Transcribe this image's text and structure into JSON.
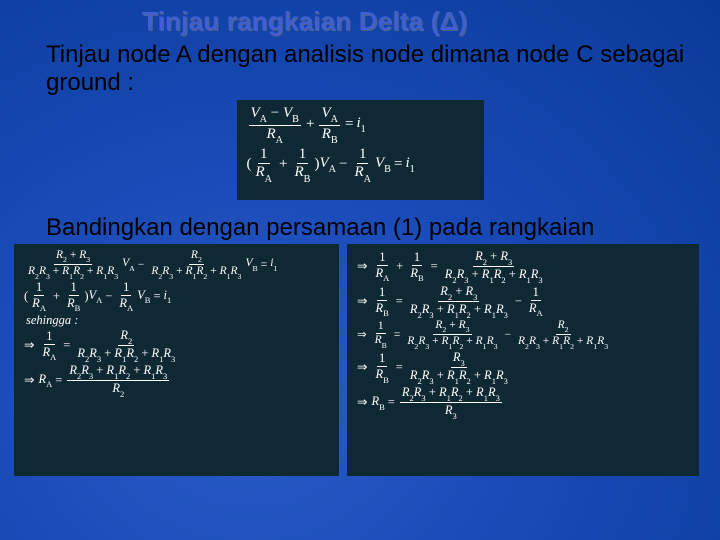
{
  "title": "Tinjau rangkaian Delta (Δ)",
  "para1": "Tinjau node A dengan analisis node dimana node C sebagai ground :",
  "para2": "Bandingkan dengan persamaan (1) pada rangkaian",
  "eq_top": {
    "l1": {
      "num1": "V_A − V_B",
      "den1": "R_A",
      "plus": "+",
      "num2": "V_A",
      "den2": "R_B",
      "eq": "=",
      "rhs": "i_1"
    },
    "l2": {
      "open": "(",
      "num1": "1",
      "den1": "R_A",
      "plus": "+",
      "num2": "1",
      "den2": "R_B",
      "close": ")",
      "VA": "V_A",
      "minus": "−",
      "num3": "1",
      "den3": "R_A",
      "VB": "V_B",
      "eq": "=",
      "rhs": "i_1"
    }
  },
  "eq_left": {
    "l1": {
      "num1": "R_2 + R_3",
      "den1": "R_2R_3 + R_1R_2 + R_1R_3",
      "VA": "V_A",
      "minus": "−",
      "num2": "R_2",
      "den2": "R_2R_3 + R_1R_2 + R_1R_3",
      "VB": "V_B",
      "eq": "=",
      "rhs": "i_1"
    },
    "l2": {
      "open": "(",
      "num1": "1",
      "den1": "R_A",
      "plus": "+",
      "num2": "1",
      "den2": "R_B",
      "close": ")",
      "VA": "V_A",
      "minus": "−",
      "num3": "1",
      "den3": "R_A",
      "VB": "V_B",
      "eq": "=",
      "rhs": "i_1"
    },
    "l3": "sehingga :",
    "l4": {
      "num1": "1",
      "den1": "R_A",
      "eq": "=",
      "num2": "R_2",
      "den2": "R_2R_3 + R_1R_2 + R_1R_3"
    },
    "l5": {
      "RA": "R_A",
      "eq": "=",
      "num": "R_2R_3 + R_1R_2 + R_1R_3",
      "den": "R_2"
    }
  },
  "eq_right": {
    "l1": {
      "num1": "1",
      "den1": "R_A",
      "plus": "+",
      "num2": "1",
      "den2": "R_B",
      "eq": "=",
      "num3": "R_2 + R_3",
      "den3": "R_2R_3 + R_1R_2 + R_1R_3"
    },
    "l2": {
      "num1": "1",
      "den1": "R_B",
      "eq": "=",
      "num2": "R_2 + R_3",
      "den2": "R_2R_3 + R_1R_2 + R_1R_3",
      "minus": "−",
      "num3": "1",
      "den3": "R_A"
    },
    "l3": {
      "num1": "1",
      "den1": "R_B",
      "eq": "=",
      "num2": "R_2 + R_3",
      "den2": "R_2R_3 + R_1R_2 + R_1R_3",
      "minus": "−",
      "num3": "R_2",
      "den3": "R_2R_3 + R_1R_2 + R_1R_3"
    },
    "l4": {
      "num1": "1",
      "den1": "R_B",
      "eq": "=",
      "num2": "R_3",
      "den2": "R_2R_3 + R_1R_2 + R_1R_3"
    },
    "l5": {
      "RB": "R_B",
      "eq": "=",
      "num": "R_2R_3 + R_1R_2 + R_1R_3",
      "den": "R_3"
    }
  }
}
